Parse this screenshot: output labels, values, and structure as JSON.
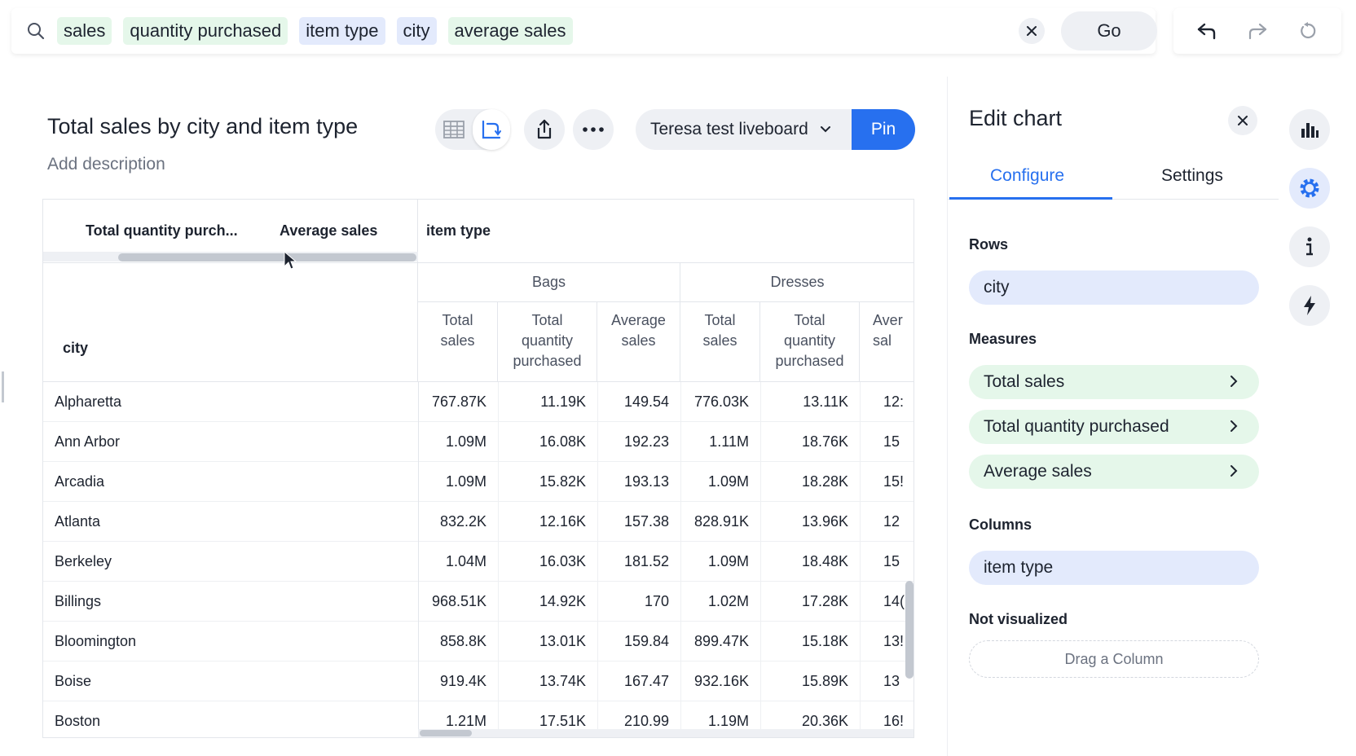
{
  "search": {
    "tokens": [
      {
        "label": "sales",
        "kind": "measure"
      },
      {
        "label": "quantity purchased",
        "kind": "measure"
      },
      {
        "label": "item type",
        "kind": "attr"
      },
      {
        "label": "city",
        "kind": "attr"
      },
      {
        "label": "average sales",
        "kind": "measure"
      }
    ],
    "go_label": "Go"
  },
  "answer": {
    "title": "Total sales by city and item type",
    "description_placeholder": "Add description",
    "liveboard": "Teresa test liveboard",
    "pin_label": "Pin"
  },
  "table": {
    "top_headers": [
      "Total quantity purch...",
      "Average sales",
      "item type"
    ],
    "row_header": "city",
    "groups": [
      "Bags",
      "Dresses"
    ],
    "subheaders": [
      [
        "Total",
        "sales"
      ],
      [
        "Total",
        "quantity",
        "purchased"
      ],
      [
        "Average",
        "sales"
      ],
      [
        "Total",
        "sales"
      ],
      [
        "Total",
        "quantity",
        "purchased"
      ],
      [
        "Aver",
        "sal"
      ]
    ],
    "rows": [
      {
        "city": "Alpharetta",
        "values": [
          "767.87K",
          "11.19K",
          "149.54",
          "776.03K",
          "13.11K",
          "12:"
        ]
      },
      {
        "city": "Ann Arbor",
        "values": [
          "1.09M",
          "16.08K",
          "192.23",
          "1.11M",
          "18.76K",
          "15"
        ]
      },
      {
        "city": "Arcadia",
        "values": [
          "1.09M",
          "15.82K",
          "193.13",
          "1.09M",
          "18.28K",
          "15!"
        ]
      },
      {
        "city": "Atlanta",
        "values": [
          "832.2K",
          "12.16K",
          "157.38",
          "828.91K",
          "13.96K",
          "12"
        ]
      },
      {
        "city": "Berkeley",
        "values": [
          "1.04M",
          "16.03K",
          "181.52",
          "1.09M",
          "18.48K",
          "15"
        ]
      },
      {
        "city": "Billings",
        "values": [
          "968.51K",
          "14.92K",
          "170",
          "1.02M",
          "17.28K",
          "14("
        ]
      },
      {
        "city": "Bloomington",
        "values": [
          "858.8K",
          "13.01K",
          "159.84",
          "899.47K",
          "15.18K",
          "13!"
        ]
      },
      {
        "city": "Boise",
        "values": [
          "919.4K",
          "13.74K",
          "167.47",
          "932.16K",
          "15.89K",
          "13"
        ]
      },
      {
        "city": "Boston",
        "values": [
          "1.21M",
          "17.51K",
          "210.99",
          "1.19M",
          "20.36K",
          "16!"
        ]
      }
    ]
  },
  "edit_panel": {
    "title": "Edit chart",
    "tabs": [
      "Configure",
      "Settings"
    ],
    "rows_label": "Rows",
    "rows": [
      "city"
    ],
    "measures_label": "Measures",
    "measures": [
      "Total sales",
      "Total quantity purchased",
      "Average sales"
    ],
    "columns_label": "Columns",
    "columns": [
      "item type"
    ],
    "not_visualized_label": "Not visualized",
    "drop_placeholder": "Drag a Column"
  },
  "colors": {
    "accent": "#2770ef",
    "measure_chip": "#e5f7ea",
    "attribute_chip": "#e3eafc"
  }
}
